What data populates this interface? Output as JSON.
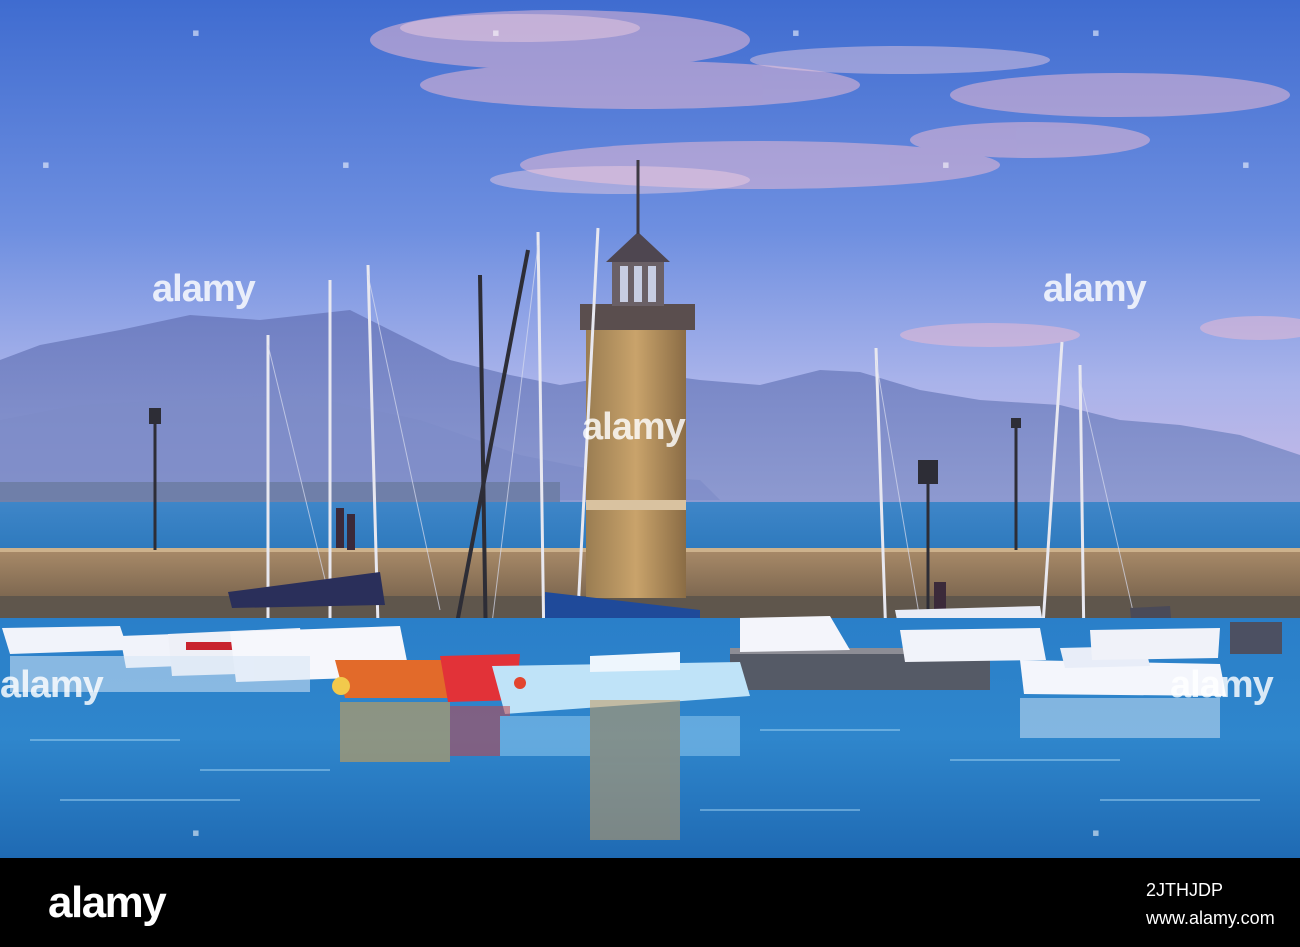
{
  "watermark": {
    "text": "alamy"
  },
  "footer": {
    "brand": "alamy",
    "image_id": "2JTHJDP",
    "site": "www.alamy.com"
  }
}
